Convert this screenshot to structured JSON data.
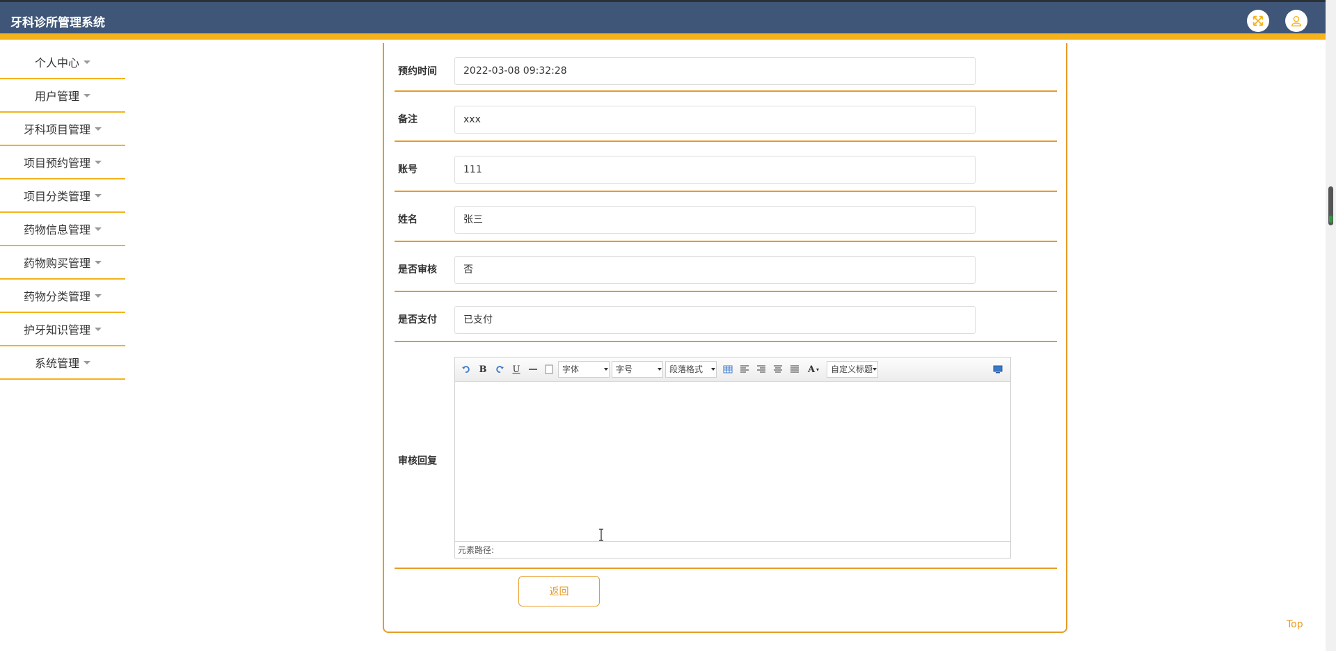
{
  "header": {
    "title": "牙科诊所管理系统",
    "colors": {
      "bar": "#3f5678",
      "accent": "#f5b21b"
    },
    "icons": [
      "fullscreen-icon",
      "user-icon"
    ]
  },
  "sidebar": {
    "items": [
      {
        "label": "个人中心"
      },
      {
        "label": "用户管理"
      },
      {
        "label": "牙科项目管理"
      },
      {
        "label": "项目预约管理"
      },
      {
        "label": "项目分类管理"
      },
      {
        "label": "药物信息管理"
      },
      {
        "label": "药物购买管理"
      },
      {
        "label": "药物分类管理"
      },
      {
        "label": "护牙知识管理"
      },
      {
        "label": "系统管理"
      }
    ]
  },
  "form": {
    "fields": [
      {
        "label": "预约时间",
        "value": "2022-03-08 09:32:28"
      },
      {
        "label": "备注",
        "value": "xxx"
      },
      {
        "label": "账号",
        "value": "111"
      },
      {
        "label": "姓名",
        "value": "张三"
      },
      {
        "label": "是否审核",
        "value": "否"
      },
      {
        "label": "是否支付",
        "value": "已支付"
      }
    ],
    "reply": {
      "label": "审核回复",
      "toolbar": {
        "font": "字体",
        "size": "字号",
        "paragraph": "段落格式",
        "custom_title": "自定义标题",
        "bold": "B",
        "underline": "U",
        "font_color": "A"
      },
      "status": "元素路径:"
    },
    "back_label": "返回"
  },
  "top_link": "Top"
}
